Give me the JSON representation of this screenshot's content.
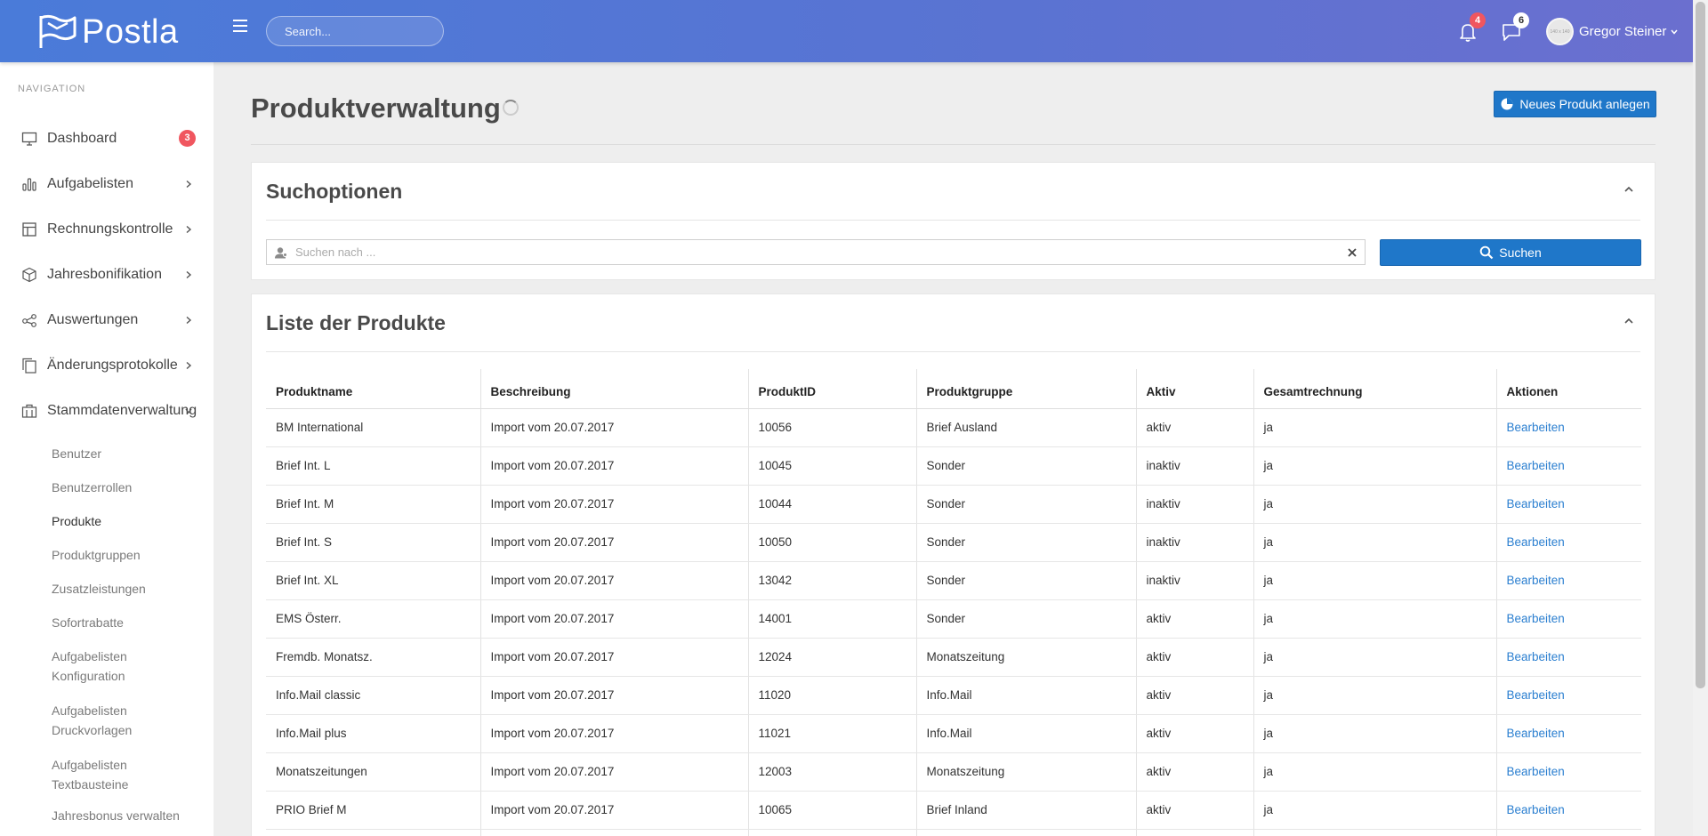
{
  "header": {
    "logo_text": "Postla",
    "search_placeholder": "Search...",
    "notifications_count": "4",
    "messages_count": "6",
    "user_name": "Gregor Steiner",
    "avatar_text": "140 x 140"
  },
  "sidebar": {
    "heading": "NAVIGATION",
    "items": [
      {
        "label": "Dashboard",
        "icon": "monitor-icon",
        "badge": "3"
      },
      {
        "label": "Aufgabelisten",
        "icon": "bar-chart-icon"
      },
      {
        "label": "Rechnungskontrolle",
        "icon": "layout-icon"
      },
      {
        "label": "Jahresbonifikation",
        "icon": "box-icon"
      },
      {
        "label": "Auswertungen",
        "icon": "share-icon"
      },
      {
        "label": "Änderungsprotokolle",
        "icon": "copy-icon"
      },
      {
        "label": "Stammdatenverwaltung",
        "icon": "briefcase-icon"
      }
    ],
    "subitems": [
      "Benutzer",
      "Benutzerrollen",
      "Produkte",
      "Produktgruppen",
      "Zusatzleistungen",
      "Sofortrabatte",
      "Aufgabelisten Konfiguration",
      "Aufgabelisten Druckvorlagen",
      "Aufgabelisten Textbausteine",
      "Jahresbonus verwalten"
    ]
  },
  "main": {
    "page_title": "Produktverwaltung",
    "new_button": "Neues Produkt anlegen",
    "search_card": {
      "title": "Suchoptionen",
      "placeholder": "Suchen nach ...",
      "button": "Suchen"
    },
    "list_card": {
      "title": "Liste der Produkte",
      "columns": [
        "Produktname",
        "Beschreibung",
        "ProduktID",
        "Produktgruppe",
        "Aktiv",
        "Gesamtrechnung",
        "Aktionen"
      ],
      "rows": [
        [
          "BM International",
          "Import vom 20.07.2017",
          "10056",
          "Brief Ausland",
          "aktiv",
          "ja",
          "Bearbeiten"
        ],
        [
          "Brief Int. L",
          "Import vom 20.07.2017",
          "10045",
          "Sonder",
          "inaktiv",
          "ja",
          "Bearbeiten"
        ],
        [
          "Brief Int. M",
          "Import vom 20.07.2017",
          "10044",
          "Sonder",
          "inaktiv",
          "ja",
          "Bearbeiten"
        ],
        [
          "Brief Int. S",
          "Import vom 20.07.2017",
          "10050",
          "Sonder",
          "inaktiv",
          "ja",
          "Bearbeiten"
        ],
        [
          "Brief Int. XL",
          "Import vom 20.07.2017",
          "13042",
          "Sonder",
          "inaktiv",
          "ja",
          "Bearbeiten"
        ],
        [
          "EMS Österr.",
          "Import vom 20.07.2017",
          "14001",
          "Sonder",
          "aktiv",
          "ja",
          "Bearbeiten"
        ],
        [
          "Fremdb. Monatsz.",
          "Import vom 20.07.2017",
          "12024",
          "Monatszeitung",
          "aktiv",
          "ja",
          "Bearbeiten"
        ],
        [
          "Info.Mail classic",
          "Import vom 20.07.2017",
          "11020",
          "Info.Mail",
          "aktiv",
          "ja",
          "Bearbeiten"
        ],
        [
          "Info.Mail plus",
          "Import vom 20.07.2017",
          "11021",
          "Info.Mail",
          "aktiv",
          "ja",
          "Bearbeiten"
        ],
        [
          "Monatszeitungen",
          "Import vom 20.07.2017",
          "12003",
          "Monatszeitung",
          "aktiv",
          "ja",
          "Bearbeiten"
        ],
        [
          "PRIO Brief M",
          "Import vom 20.07.2017",
          "10065",
          "Brief Inland",
          "aktiv",
          "ja",
          "Bearbeiten"
        ],
        [
          "",
          "",
          "",
          "",
          "",
          "",
          ""
        ]
      ]
    }
  },
  "colors": {
    "header_start": "#4a7bd9",
    "header_end": "#6b6fcf",
    "primary_button": "#1f77c9",
    "link": "#2b7fd0",
    "badge_red": "#f0565f"
  }
}
